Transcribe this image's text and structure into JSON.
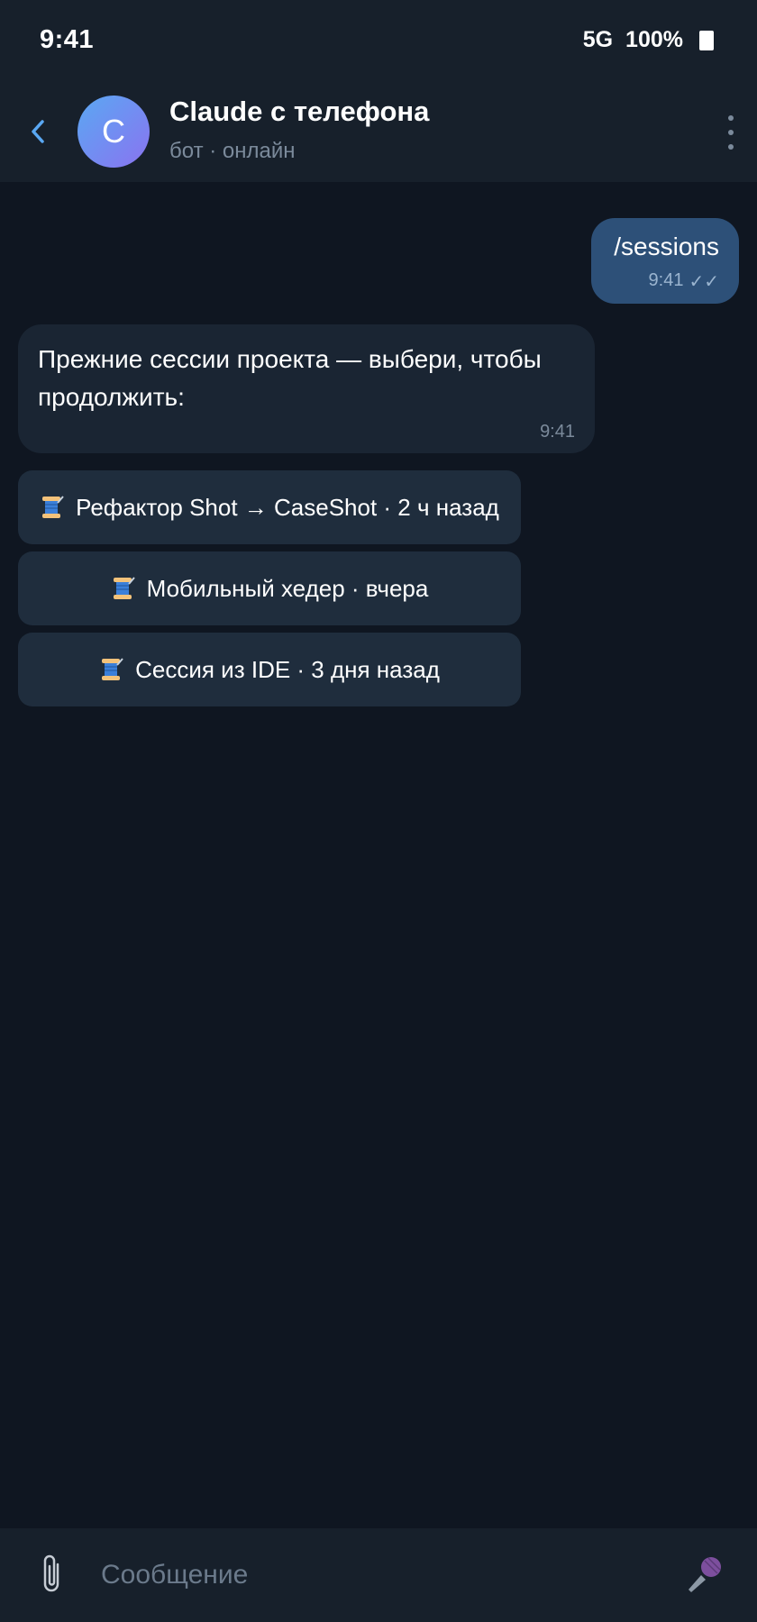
{
  "status_bar": {
    "time": "9:41",
    "network": "5G",
    "battery": "100%"
  },
  "header": {
    "avatar_letter": "C",
    "title": "Claude с телефона",
    "subtitle": "бот · онлайн",
    "icons": {
      "back": "back-icon",
      "menu": "more-vertical-icon"
    }
  },
  "messages": [
    {
      "direction": "outgoing",
      "text": "/sessions",
      "time": "9:41",
      "status": "✓✓"
    },
    {
      "direction": "incoming",
      "text": "Прежние сессии проекта — выбери, чтобы продолжить:",
      "time": "9:41"
    }
  ],
  "inline_buttons": [
    {
      "label": "Рефактор Shot → CaseShot · 2 ч назад",
      "icon": "spool-icon"
    },
    {
      "label": "Мобильный хедер · вчера",
      "icon": "spool-icon"
    },
    {
      "label": "Сессия из IDE · 3 дня назад",
      "icon": "spool-icon"
    }
  ],
  "composer": {
    "placeholder": "Сообщение",
    "icons": {
      "attach": "paperclip-icon",
      "mic": "microphone-icon"
    }
  },
  "colors": {
    "background": "#0f1621",
    "bar": "#17202b",
    "outgoing_bubble": "#2d5078",
    "incoming_bubble": "#1a2533",
    "button": "#1f2d3d",
    "accent": "#5aa8f3"
  }
}
